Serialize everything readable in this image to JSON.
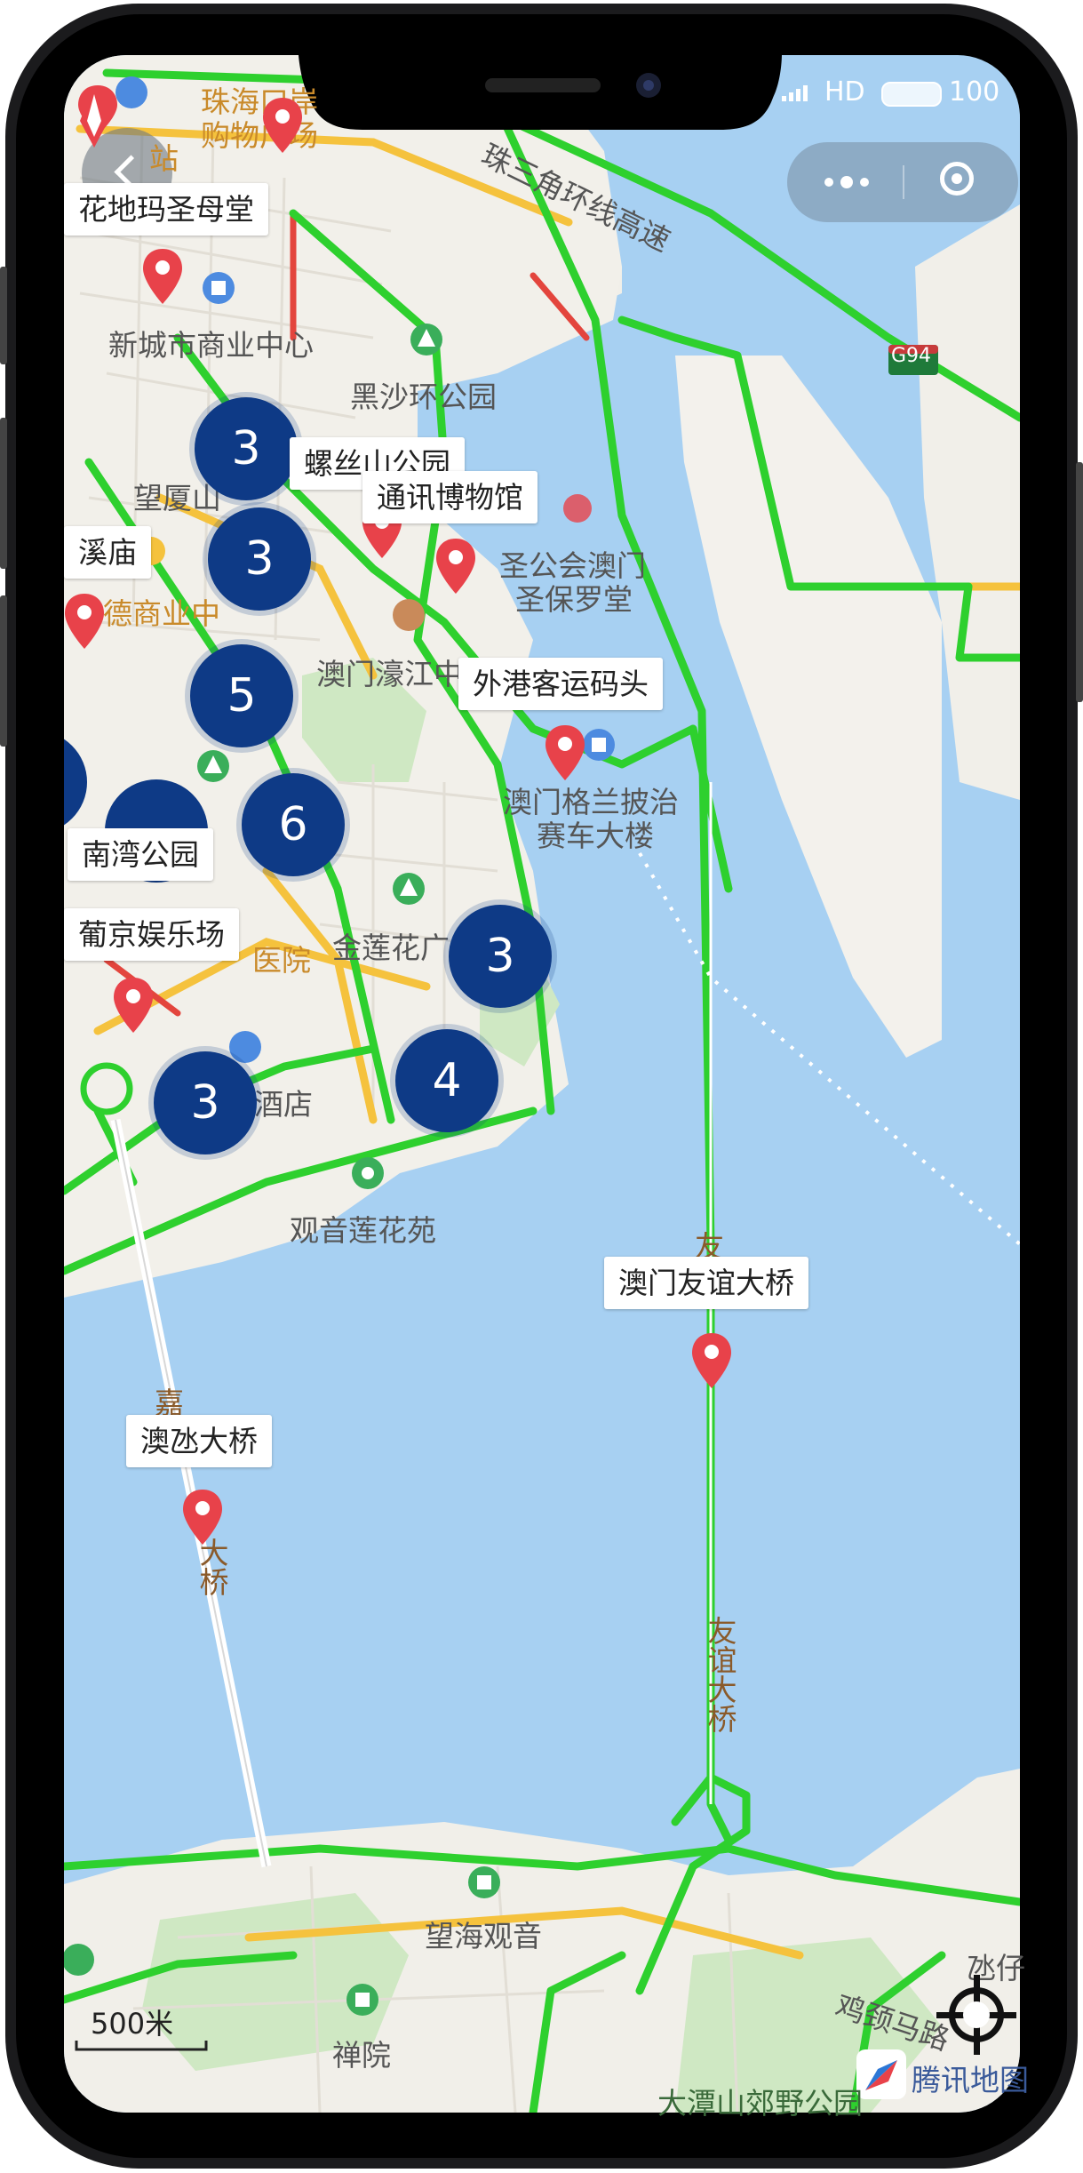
{
  "status_bar": {
    "signal": "HD",
    "battery": "100"
  },
  "capsule": {
    "more_icon": "more-dots-icon",
    "close_icon": "target-close-icon"
  },
  "map": {
    "labels": {
      "huadi": "花地玛圣母堂",
      "luosi": "螺丝山公园",
      "tongxun": "通讯博物馆",
      "xi": "溪庙",
      "waigang": "外港客运码头",
      "nanwan": "南湾公园",
      "pujing": "葡京娱乐场",
      "youyi": "澳门友谊大桥",
      "aozai": "澳氹大桥"
    },
    "clusters": [
      "3",
      "3",
      "5",
      "6",
      "3",
      "4",
      "3"
    ],
    "place_names": {
      "zhuhai": "珠海口岸",
      "gouwu": "购物广场",
      "zhusanjiao": "珠三角环线高速",
      "g94": "G94",
      "xincheng": "新城市商业中心",
      "heisha": "黑沙环公园",
      "wangxia": "望厦山",
      "shenggonghui": "圣公会澳门",
      "shengbaoluo": "圣保罗堂",
      "haojiang": "澳门濠江中",
      "dexing": "德商业中",
      "gelan": "澳门格兰披治",
      "saiche": "赛车大楼",
      "jinlian": "金莲花广",
      "yiyuan": "医院",
      "jiudian": "酒店",
      "guanyin": "观音莲花苑",
      "you": "友",
      "jia": "嘉",
      "daqiao": "大桥",
      "youyidaqiao": "友谊大桥",
      "wanghai": "望海观音",
      "chanyuan": "禅院",
      "jijing": "鸡颈马路",
      "bingzai": "氹仔",
      "datan": "大潭山郊野公园",
      "tengxun": "腾讯地图",
      "zhan": "站"
    },
    "scale": "500米",
    "colors": {
      "water": "#a7d0f2",
      "land": "#f2f1ee",
      "road_green": "#2ed02e",
      "road_yellow": "#f5c23d",
      "cluster": "#0e3a86",
      "pin": "#e8424a"
    }
  }
}
